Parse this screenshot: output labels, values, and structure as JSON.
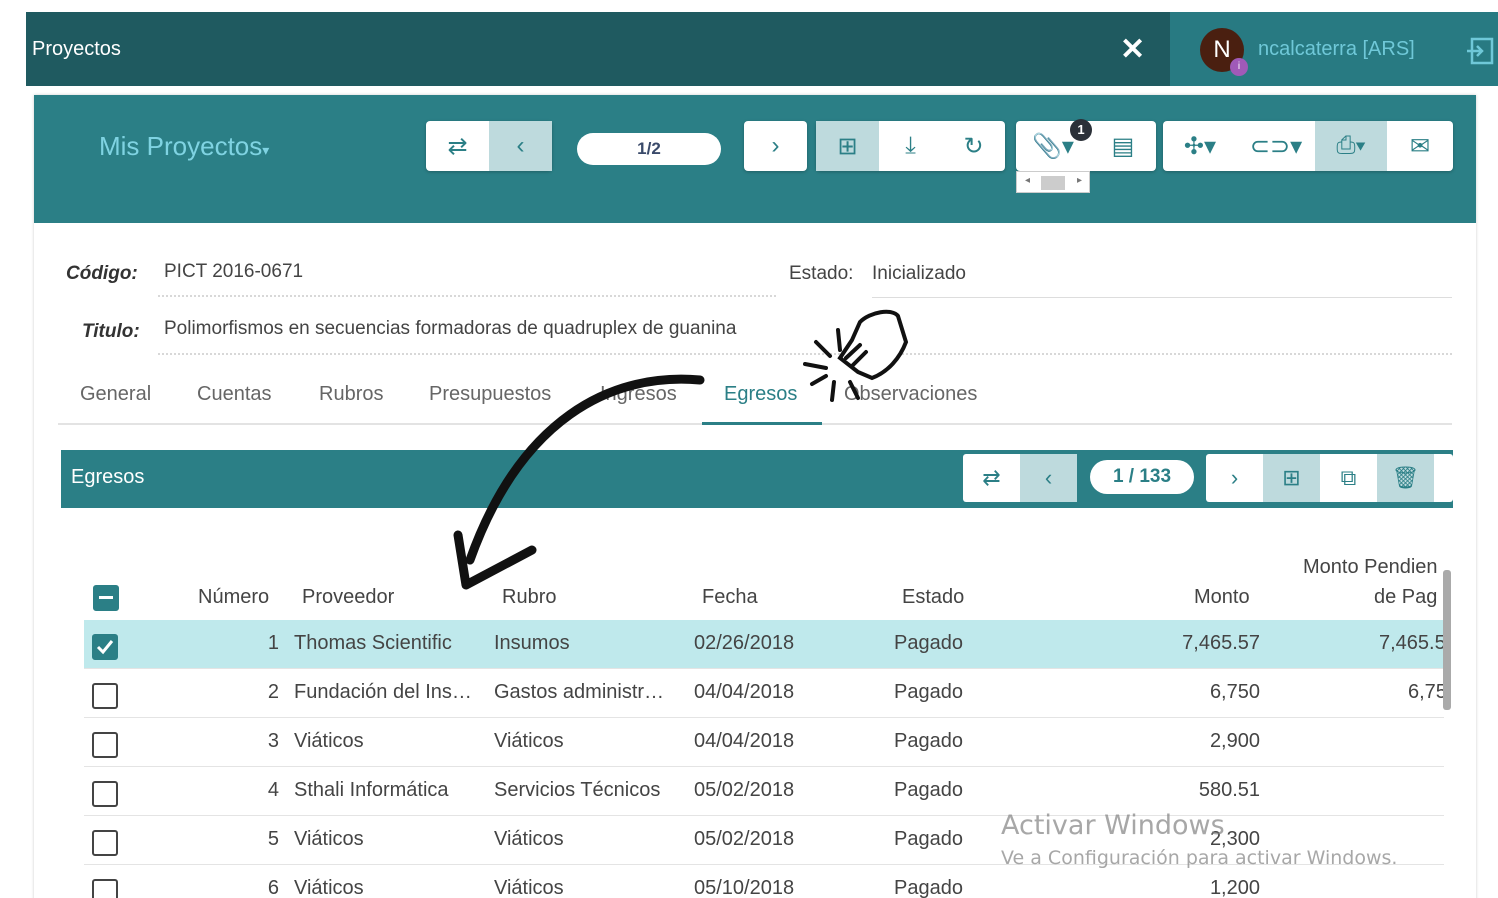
{
  "topbar": {
    "title": "Proyectos",
    "close_icon": "close-icon"
  },
  "user": {
    "initial": "N",
    "dot": "i",
    "name": "ncalcaterra [ARS]"
  },
  "header": {
    "my_projects": "Mis Proyectos",
    "pager": "1/2",
    "attach_count": "1"
  },
  "project": {
    "code_label": "Código:",
    "code": "PICT 2016-0671",
    "state_label": "Estado:",
    "state": "Inicializado",
    "title_label": "Titulo:",
    "title": "Polimorfismos en secuencias formadoras de quadruplex de guanina"
  },
  "tabs": [
    "General",
    "Cuentas",
    "Rubros",
    "Presupuestos",
    "Ingresos",
    "Egresos",
    "Observaciones"
  ],
  "egresos": {
    "title": "Egresos",
    "pager": "1 / 133",
    "columns": [
      "Número",
      "Proveedor",
      "Rubro",
      "Fecha",
      "Estado",
      "Monto",
      "Monto Pendien",
      "de Pag"
    ],
    "rows": [
      {
        "n": "1",
        "prov": "Thomas Scientific",
        "rubro": "Insumos",
        "fecha": "02/26/2018",
        "estado": "Pagado",
        "monto": "7,465.57",
        "pend": "7,465.5"
      },
      {
        "n": "2",
        "prov": "Fundación del Ins…",
        "rubro": "Gastos administr…",
        "fecha": "04/04/2018",
        "estado": "Pagado",
        "monto": "6,750",
        "pend": "6,75"
      },
      {
        "n": "3",
        "prov": "Viáticos",
        "rubro": "Viáticos",
        "fecha": "04/04/2018",
        "estado": "Pagado",
        "monto": "2,900",
        "pend": ""
      },
      {
        "n": "4",
        "prov": "Sthali Informática",
        "rubro": "Servicios Técnicos",
        "fecha": "05/02/2018",
        "estado": "Pagado",
        "monto": "580.51",
        "pend": ""
      },
      {
        "n": "5",
        "prov": "Viáticos",
        "rubro": "Viáticos",
        "fecha": "05/02/2018",
        "estado": "Pagado",
        "monto": "2,300",
        "pend": ""
      },
      {
        "n": "6",
        "prov": "Viáticos",
        "rubro": "Viáticos",
        "fecha": "05/10/2018",
        "estado": "Pagado",
        "monto": "1,200",
        "pend": ""
      }
    ]
  },
  "watermark": {
    "line1": "Activar Windows",
    "line2": "Ve a Configuración para activar Windows."
  },
  "colors": {
    "teal_dark": "#1f5a60",
    "teal": "#2b7f86",
    "selected_row": "#bfe9ec"
  }
}
